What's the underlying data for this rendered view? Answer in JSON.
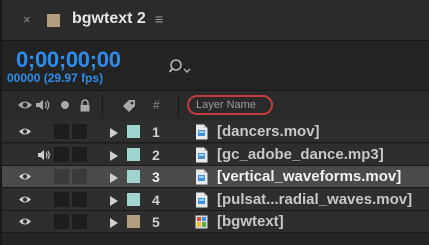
{
  "comp_tab": {
    "close_glyph": "×",
    "title": "bgwtext 2",
    "menu_glyph": "≡",
    "swatch_color": "#b29d7f"
  },
  "timecode": {
    "value": "0;00;00;00",
    "frames": "00000 (29.97 fps)",
    "color": "#2d8ceb",
    "search_icon": "search-icon"
  },
  "header": {
    "icons": [
      "eye-icon",
      "speaker-icon",
      "solo-dot-icon",
      "lock-icon",
      "label-tag-icon"
    ],
    "num_label": "#",
    "layer_name_label": "Layer Name",
    "highlight_color": "#c23a3a"
  },
  "layers": [
    {
      "num": "1",
      "name": "[dancers.mov]",
      "label_color": "#9fd4cf",
      "file_icon": "footage-file-icon",
      "video": true,
      "audio": false,
      "selected": false
    },
    {
      "num": "2",
      "name": "[gc_adobe_dance.mp3]",
      "label_color": "#9fd4cf",
      "file_icon": "audio-file-icon",
      "video": false,
      "audio": true,
      "selected": false
    },
    {
      "num": "3",
      "name": "[vertical_waveforms.mov]",
      "label_color": "#9fd4cf",
      "file_icon": "footage-file-icon",
      "video": true,
      "audio": false,
      "selected": true
    },
    {
      "num": "4",
      "name": "[pulsat...radial_waves.mov]",
      "label_color": "#9fd4cf",
      "file_icon": "footage-file-icon",
      "video": true,
      "audio": false,
      "selected": false
    },
    {
      "num": "5",
      "name": "[bgwtext]",
      "label_color": "#b29d7f",
      "file_icon": "composition-icon",
      "video": true,
      "audio": false,
      "selected": false
    }
  ]
}
